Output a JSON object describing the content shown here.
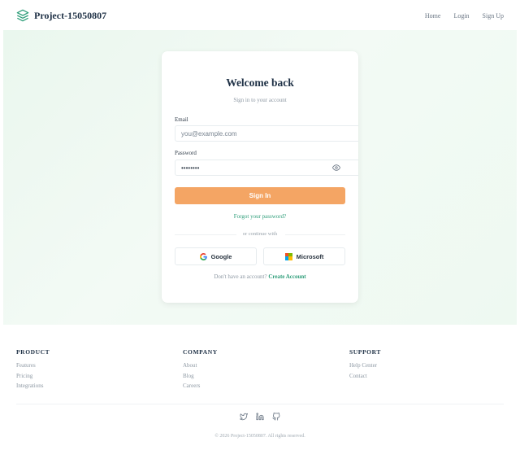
{
  "header": {
    "brand": "Project-15050807",
    "nav": [
      "Home",
      "Login",
      "Sign Up"
    ]
  },
  "card": {
    "title": "Welcome back",
    "subtitle": "Sign in to your account",
    "email_label": "Email",
    "email_placeholder": "you@example.com",
    "password_label": "Password",
    "password_value": "••••••••",
    "signin_label": "Sign In",
    "forgot_label": "Forgot your password?",
    "divider_label": "or continue with",
    "google_label": "Google",
    "microsoft_label": "Microsoft",
    "signup_prompt": "Don't have an account?",
    "signup_link": "Create Account"
  },
  "footer": {
    "product": {
      "heading": "PRODUCT",
      "links": [
        "Features",
        "Pricing",
        "Integrations"
      ]
    },
    "company": {
      "heading": "COMPANY",
      "links": [
        "About",
        "Blog",
        "Careers"
      ]
    },
    "support": {
      "heading": "SUPPORT",
      "links": [
        "Help Center",
        "Contact"
      ]
    },
    "copyright": "© 2026 Project-15050807. All rights reserved."
  },
  "icons": {
    "brand": "layers-icon",
    "password_toggle": "eye-icon",
    "social": [
      "twitter-icon",
      "linkedin-icon",
      "github-icon"
    ]
  },
  "colors": {
    "accent": "#f4a564",
    "link": "#2f9e7a",
    "heading": "#1f3146"
  }
}
